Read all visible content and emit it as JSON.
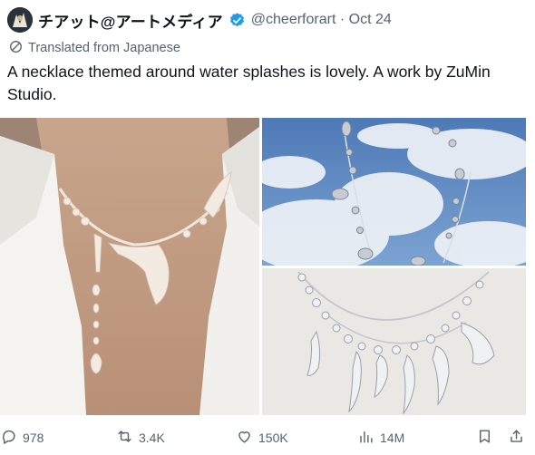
{
  "tweet": {
    "display_name": "チアット@アートメディア",
    "handle": "@cheerforart",
    "separator": "·",
    "date": "Oct 24",
    "translation_note": "Translated from Japanese",
    "text": "A necklace themed around water splashes is lovely. A work by ZuMin Studio."
  },
  "media": {
    "images": [
      {
        "name": "necklace-on-model"
      },
      {
        "name": "necklace-against-sky"
      },
      {
        "name": "necklace-on-white-background"
      }
    ]
  },
  "actions": {
    "replies": "978",
    "reposts": "3.4K",
    "likes": "150K",
    "views": "14M"
  },
  "colors": {
    "text": "#0f1419",
    "secondary": "#536471",
    "verified": "#1d9bf0"
  },
  "icons": [
    "verified-badge-icon",
    "translate-icon",
    "reply-icon",
    "repost-icon",
    "like-icon",
    "views-icon",
    "bookmark-icon",
    "share-icon"
  ]
}
